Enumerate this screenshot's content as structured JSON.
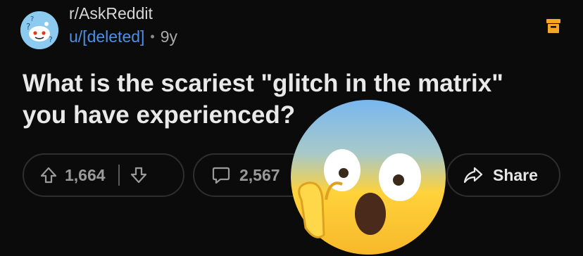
{
  "header": {
    "subreddit": "r/AskReddit",
    "author": "u/[deleted]",
    "separator": "•",
    "age": "9y"
  },
  "post": {
    "title_line1": "What is the scariest \"glitch in the matrix\"",
    "title_line2": "you have experienced?"
  },
  "actions": {
    "upvotes": "1,664",
    "comments": "2,567",
    "share_label": "Share"
  },
  "icons": {
    "avatar": "subreddit-askreddit-icon",
    "archive": "archive-icon",
    "upvote": "upvote-arrow-icon",
    "downvote": "downvote-arrow-icon",
    "comment": "comment-bubble-icon",
    "share": "share-arrow-icon",
    "emoji": "screaming-face-emoji"
  },
  "colors": {
    "background": "#0b0b0c",
    "author_link": "#4d8fe5",
    "archive_icon": "#f5a623",
    "pill_border": "#2e2e30"
  }
}
